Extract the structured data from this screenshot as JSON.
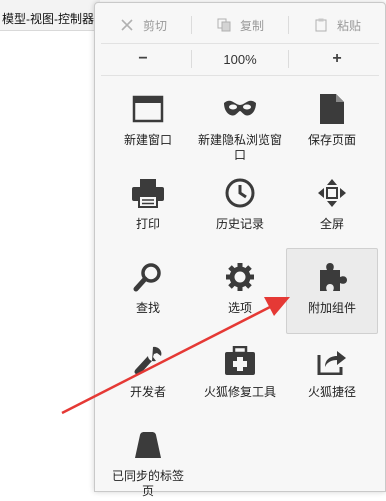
{
  "background": {
    "window_title": "模型-视图-控制器"
  },
  "edit": {
    "cut": "剪切",
    "copy": "复制",
    "paste": "粘贴"
  },
  "zoom": {
    "minus": "−",
    "value": "100%",
    "plus": "+"
  },
  "items": [
    {
      "label": "新建窗口",
      "icon": "new-window-icon"
    },
    {
      "label": "新建隐私浏览窗口",
      "icon": "private-mask-icon"
    },
    {
      "label": "保存页面",
      "icon": "save-page-icon"
    },
    {
      "label": "打印",
      "icon": "printer-icon"
    },
    {
      "label": "历史记录",
      "icon": "history-clock-icon"
    },
    {
      "label": "全屏",
      "icon": "fullscreen-icon"
    },
    {
      "label": "查找",
      "icon": "search-magnifier-icon"
    },
    {
      "label": "选项",
      "icon": "gear-icon"
    },
    {
      "label": "附加组件",
      "icon": "puzzle-piece-icon"
    },
    {
      "label": "开发者",
      "icon": "wrench-icon"
    },
    {
      "label": "火狐修复工具",
      "icon": "repair-kit-icon"
    },
    {
      "label": "火狐捷径",
      "icon": "share-arrow-icon"
    },
    {
      "label": "已同步的标签页",
      "icon": "synced-tabs-icon"
    }
  ],
  "colors": {
    "icon": "#3b3b3b",
    "arrow": "#e53935",
    "hover_bg": "#ebebeb"
  }
}
